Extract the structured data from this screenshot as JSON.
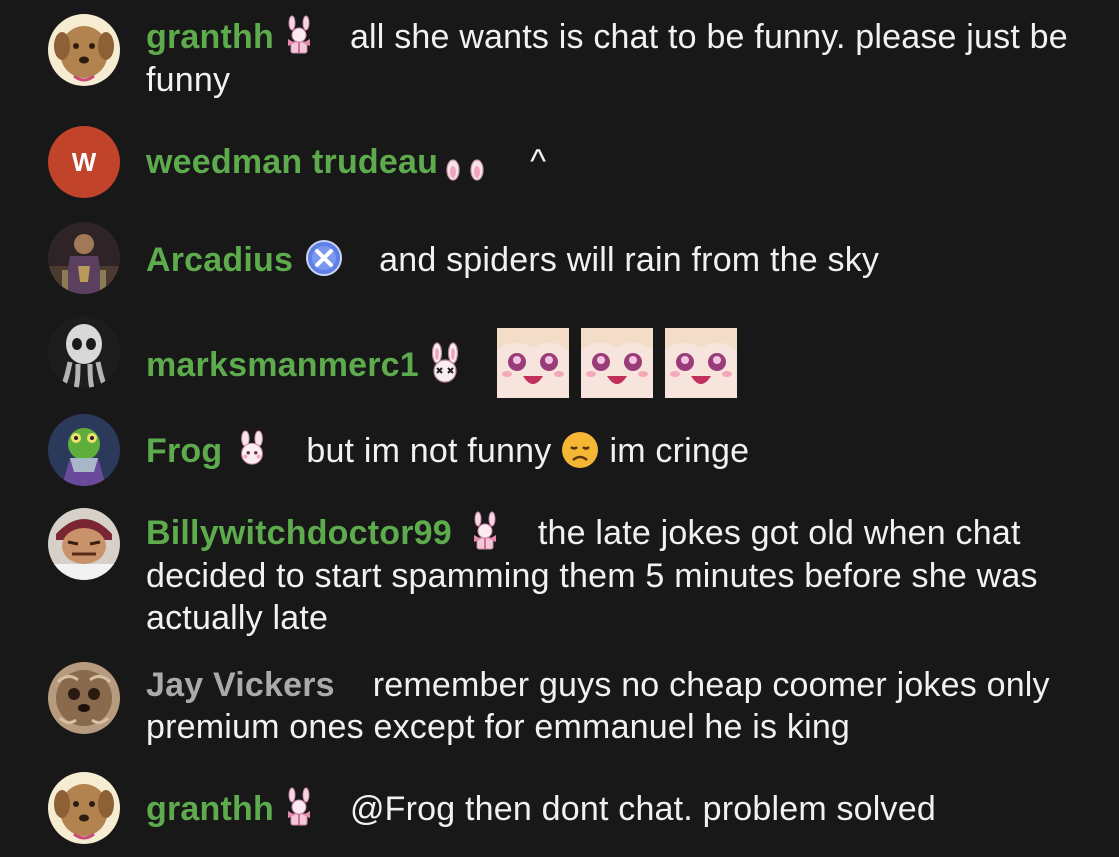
{
  "messages": [
    {
      "author": "granthh",
      "text": "all she wants is chat to be funny. please just be funny",
      "avatar": "dog-avatar",
      "badge": "bunny-gift-badge"
    },
    {
      "author": "weedman trudeau",
      "text": "^",
      "avatar": "letter-avatar",
      "avatar_letter": "W",
      "avatar_color": "#c0432a",
      "badge": "bunny-ears-badge"
    },
    {
      "author": "Arcadius",
      "text": "and spiders will rain from the sky",
      "avatar": "knight-avatar",
      "badge": "blue-x-badge"
    },
    {
      "author": "marksmanmerc1",
      "text": "",
      "avatar": "skull-avatar",
      "badge": "dead-bunny-badge",
      "emotes": [
        "anime-face-emote",
        "anime-face-emote",
        "anime-face-emote"
      ]
    },
    {
      "author": "Frog",
      "text_before": "but im not funny",
      "emoji": "disappointed-face-emoji",
      "text_after": "im cringe",
      "avatar": "frog-avatar",
      "badge": "bunny-face-badge"
    },
    {
      "author": "Billywitchdoctor99",
      "text": "the late jokes got old when chat decided to start spamming them 5 minutes before she was actually late",
      "avatar": "face-avatar",
      "badge": "bunny-gift-badge"
    },
    {
      "author": "Jay Vickers",
      "text": "remember guys no cheap coomer jokes only premium ones except for emmanuel he is king",
      "avatar": "furry-dog-avatar"
    },
    {
      "author": "granthh",
      "text": "@Frog then dont chat. problem solved",
      "avatar": "dog-avatar",
      "badge": "bunny-gift-badge"
    }
  ],
  "colors": {
    "background": "#181818",
    "member_name": "#5dab4d",
    "plain_name": "#aaaaaa",
    "text": "#f1f1f1"
  }
}
